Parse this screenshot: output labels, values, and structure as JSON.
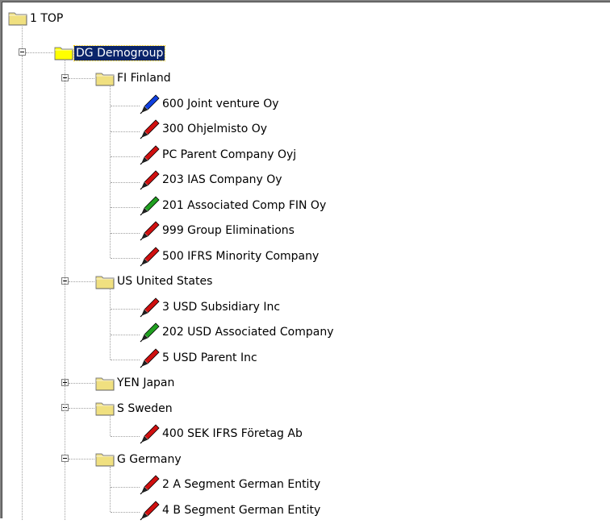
{
  "tree": {
    "root": {
      "label": "1 TOP"
    },
    "group": {
      "label": "DG Demogroup"
    },
    "countries": [
      {
        "label": "FI Finland",
        "expanded": true,
        "companies": [
          {
            "label": "600 Joint venture Oy",
            "color": "#1040e0"
          },
          {
            "label": "300 Ohjelmisto Oy",
            "color": "#d01010"
          },
          {
            "label": "PC Parent Company Oyj",
            "color": "#d01010"
          },
          {
            "label": "203 IAS Company Oy",
            "color": "#d01010"
          },
          {
            "label": "201 Associated Comp FIN Oy",
            "color": "#20a020"
          },
          {
            "label": "999 Group Eliminations",
            "color": "#d01010"
          },
          {
            "label": "500 IFRS Minority Company",
            "color": "#d01010"
          }
        ]
      },
      {
        "label": "US United States",
        "expanded": true,
        "companies": [
          {
            "label": "3 USD Subsidiary Inc",
            "color": "#d01010"
          },
          {
            "label": "202 USD Associated Company",
            "color": "#20a020"
          },
          {
            "label": "5 USD Parent Inc",
            "color": "#d01010"
          }
        ]
      },
      {
        "label": "YEN Japan",
        "expanded": false,
        "companies": []
      },
      {
        "label": "S Sweden",
        "expanded": true,
        "companies": [
          {
            "label": "400 SEK IFRS Företag Ab",
            "color": "#d01010"
          }
        ]
      },
      {
        "label": "G Germany",
        "expanded": true,
        "companies": [
          {
            "label": "2 A Segment German Entity",
            "color": "#d01010"
          },
          {
            "label": "4 B Segment German Entity",
            "color": "#d01010"
          }
        ]
      }
    ]
  }
}
